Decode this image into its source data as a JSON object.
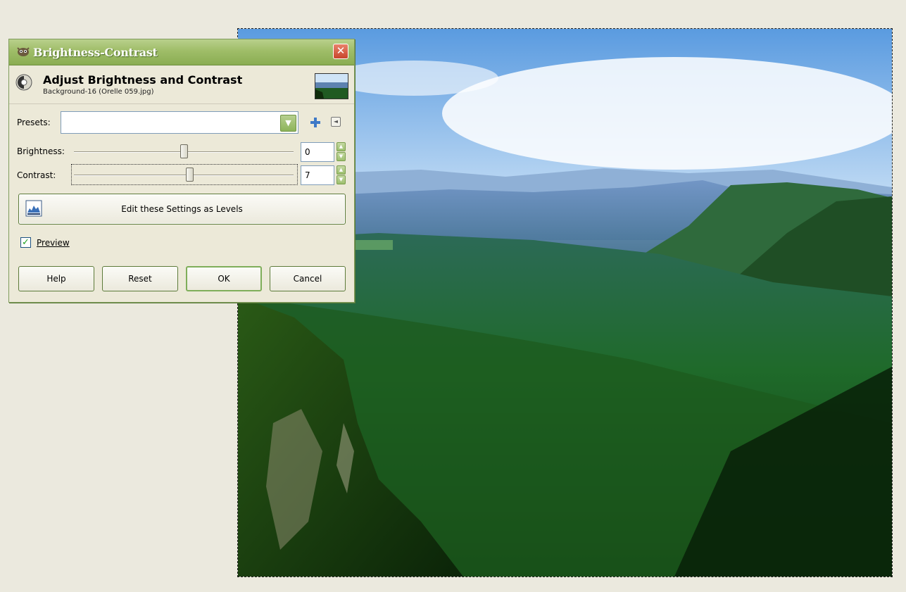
{
  "dialog": {
    "window_title": "Brightness-Contrast",
    "close_glyph": "✕",
    "header_title": "Adjust Brightness and Contrast",
    "header_subtitle": "Background-16 (Orelle 059.jpg)",
    "presets_label": "Presets:",
    "presets_value": "",
    "brightness_label": "Brightness:",
    "brightness_value": "0",
    "brightness_level": 0,
    "contrast_label": "Contrast:",
    "contrast_value": "7",
    "contrast_level": 7,
    "slider_range": [
      -127,
      127
    ],
    "levels_button": "Edit these Settings as Levels",
    "preview_label": "Preview",
    "preview_checked": true,
    "buttons": {
      "help": "Help",
      "reset": "Reset",
      "ok": "OK",
      "cancel": "Cancel"
    }
  },
  "icons": {
    "app": "gimp-icon",
    "tool": "brightness-contrast-icon",
    "add": "add-preset-icon",
    "menu": "preset-menu-icon",
    "levels": "levels-icon"
  },
  "colors": {
    "titlebar": "#9fbd68",
    "dialog_bg": "#ece9d8",
    "workspace_bg": "#ebe9de",
    "close_button": "#c8452c"
  }
}
